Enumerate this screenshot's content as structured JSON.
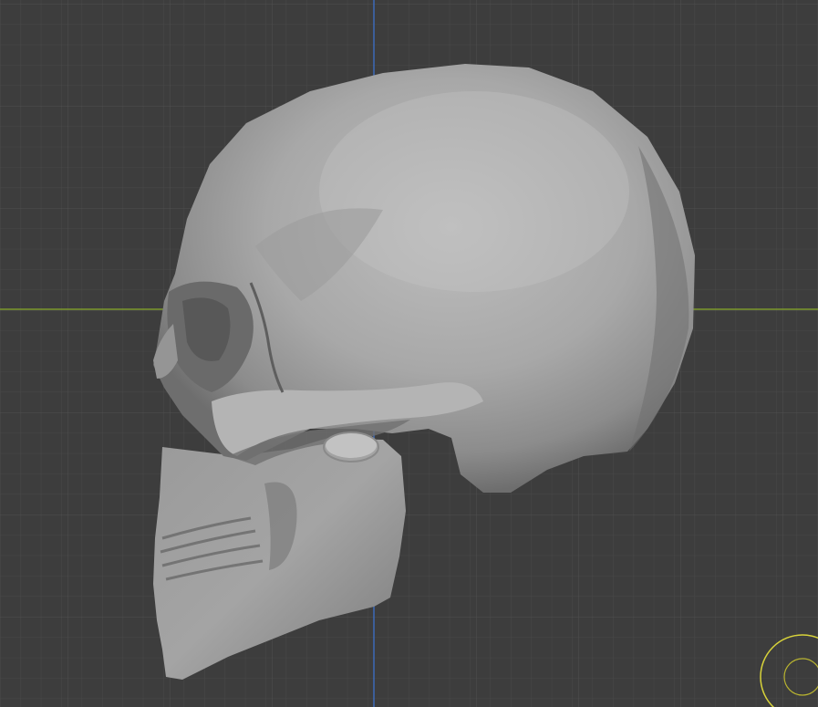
{
  "viewport": {
    "mode": "sculpt",
    "background": "#3d3d3d",
    "grid_minor_color": "#474747",
    "grid_major_color": "#505050",
    "x_axis_color": "#7d9a2c",
    "y_axis_color": "#3d6ab8",
    "model": {
      "name": "skull",
      "view": "side",
      "base_color": "#a9a9a9"
    },
    "gizmo": {
      "name": "brush-cursor",
      "color": "#d8d33a"
    }
  }
}
